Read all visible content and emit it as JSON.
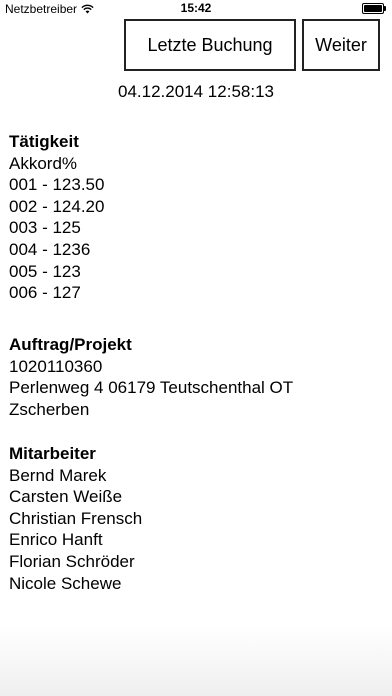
{
  "status_bar": {
    "carrier": "Netzbetreiber",
    "time": "15:42",
    "icons": [
      "wifi-icon",
      "battery-icon"
    ]
  },
  "toolbar": {
    "last_booking_label": "Letzte Buchung",
    "next_label": "Weiter"
  },
  "datetime": "04.12.2014 12:58:13",
  "activity": {
    "heading": "Tätigkeit",
    "lines": [
      "Akkord%",
      "001 - 123.50",
      "002 - 124.20",
      "003 - 125",
      "004 - 1236",
      "005 - 123",
      "006 - 127"
    ]
  },
  "order": {
    "heading": "Auftrag/Projekt",
    "lines": [
      "1020110360",
      "Perlenweg 4 06179 Teutschenthal OT",
      "Zscherben"
    ]
  },
  "staff": {
    "heading": "Mitarbeiter",
    "lines": [
      "Bernd Marek",
      "Carsten Weiße",
      "Christian Frensch",
      "Enrico Hanft",
      "Florian Schröder",
      "Nicole Schewe"
    ]
  }
}
